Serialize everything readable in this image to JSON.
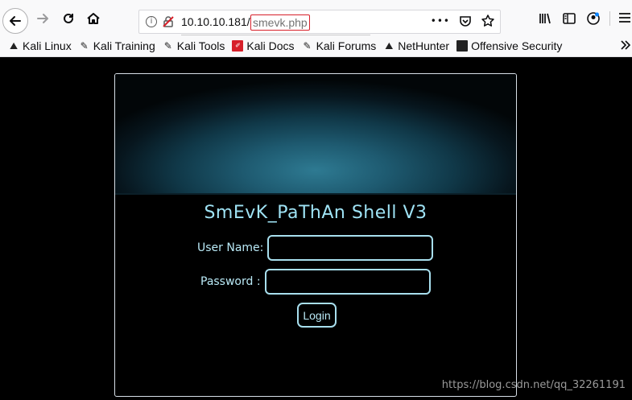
{
  "browser": {
    "url_host": "10.10.10.181/",
    "url_path": "smevk.php",
    "more_actions_glyph": "•••",
    "icons": [
      "back-arrow-icon",
      "forward-arrow-icon",
      "reload-icon",
      "home-icon",
      "info-icon",
      "insecure-lock-icon",
      "pocket-icon",
      "star-icon",
      "library-icon",
      "sidebar-icon",
      "account-icon",
      "hamburger-menu-icon",
      "overflow-chevron-icon"
    ]
  },
  "bookmarks": [
    {
      "label": "Kali Linux",
      "icon": "kali-dragon-icon"
    },
    {
      "label": "Kali Training",
      "icon": "kali-training-icon"
    },
    {
      "label": "Kali Tools",
      "icon": "kali-tools-icon"
    },
    {
      "label": "Kali Docs",
      "icon": "kali-docs-icon"
    },
    {
      "label": "Kali Forums",
      "icon": "kali-forums-icon"
    },
    {
      "label": "NetHunter",
      "icon": "nethunter-icon"
    },
    {
      "label": "Offensive Security",
      "icon": "offsec-icon"
    }
  ],
  "shell": {
    "title": "SmEvK_PaThAn Shell V3",
    "username_label": "User Name:",
    "username_value": "",
    "password_label": "Password :",
    "password_value": "",
    "login_label": "Login"
  },
  "watermark": "https://blog.csdn.net/qq_32261191",
  "colors": {
    "accent": "#a8dfee",
    "title": "#9fe3f5",
    "url_highlight": "#d7202a"
  }
}
